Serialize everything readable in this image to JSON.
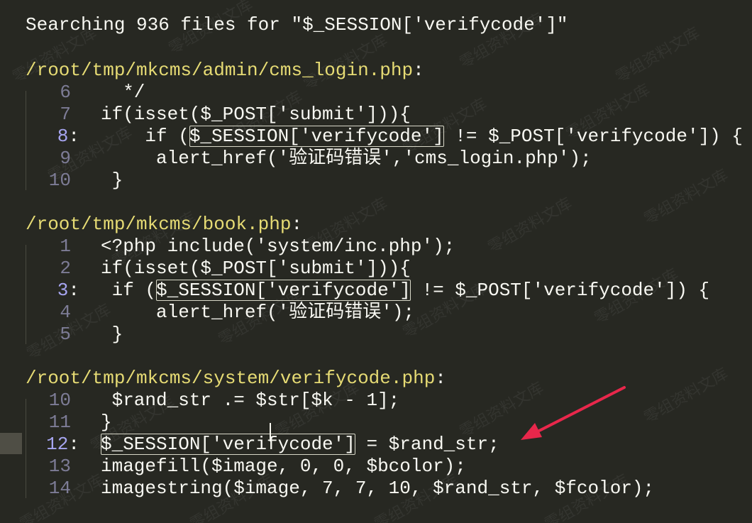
{
  "search": {
    "header": "Searching 936 files for \"$_SESSION['verifycode']\""
  },
  "results": [
    {
      "path": "/root/tmp/mkcms/admin/cms_login.php",
      "lines": [
        {
          "num": "6",
          "sep": "",
          "code": "  */"
        },
        {
          "num": "7",
          "sep": "",
          "code": "if(isset($_POST['submit'])){"
        },
        {
          "num": "8",
          "sep": ":",
          "code": "    if ($_SESSION['verifycode'] != $_POST['verifycode']) {",
          "match": true
        },
        {
          "num": "9",
          "sep": "",
          "code": "     alert_href('验证码错误','cms_login.php');"
        },
        {
          "num": "10",
          "sep": "",
          "code": " }"
        }
      ]
    },
    {
      "path": "/root/tmp/mkcms/book.php",
      "lines": [
        {
          "num": "1",
          "sep": "",
          "code": "<?php include('system/inc.php');"
        },
        {
          "num": "2",
          "sep": "",
          "code": "if(isset($_POST['submit'])){"
        },
        {
          "num": "3",
          "sep": ":",
          "code": " if ($_SESSION['verifycode'] != $_POST['verifycode']) {",
          "match": true
        },
        {
          "num": "4",
          "sep": "",
          "code": "     alert_href('验证码错误');"
        },
        {
          "num": "5",
          "sep": "",
          "code": " }"
        }
      ]
    },
    {
      "path": "/root/tmp/mkcms/system/verifycode.php",
      "lines": [
        {
          "num": "10",
          "sep": "",
          "code": " $rand_str .= $str[$k - 1];"
        },
        {
          "num": "11",
          "sep": "",
          "code": "}"
        },
        {
          "num": "12",
          "sep": ":",
          "code": "$_SESSION['verifycode'] = $rand_str;",
          "match": true
        },
        {
          "num": "13",
          "sep": "",
          "code": "imagefill($image, 0, 0, $bcolor);"
        },
        {
          "num": "14",
          "sep": "",
          "code": "imagestring($image, 7, 7, 10, $rand_str, $fcolor);"
        }
      ]
    }
  ],
  "watermark_text": "零组资料文库",
  "colors": {
    "background": "#272822",
    "path": "#e6db74",
    "line_number": "#7d7c96",
    "arrow": "#e8274b"
  }
}
